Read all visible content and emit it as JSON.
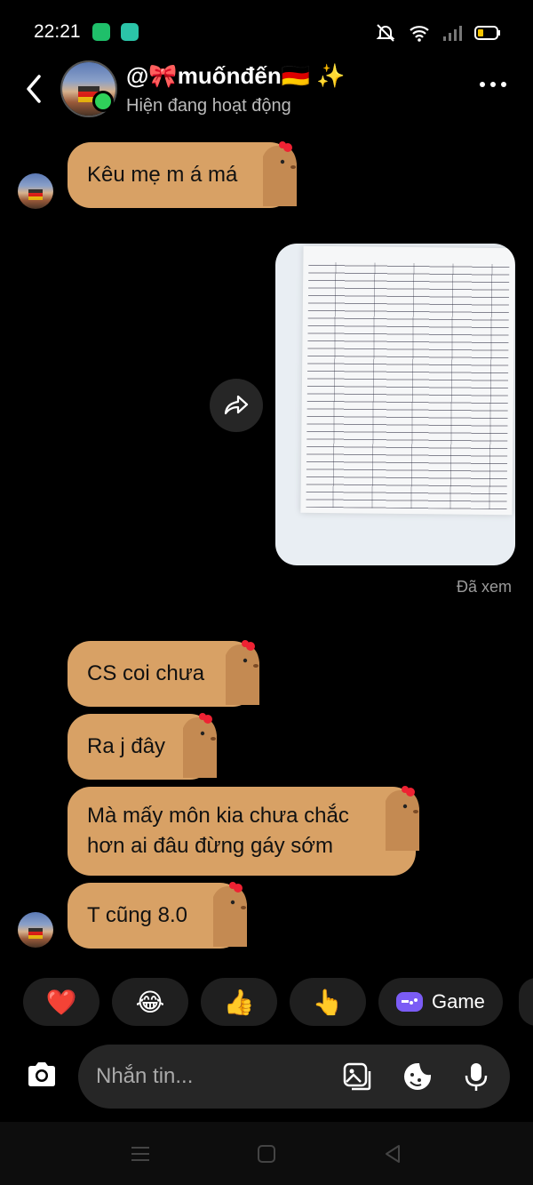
{
  "status_bar": {
    "time": "22:21"
  },
  "header": {
    "contact_name": "@🎀muốnđến🇩🇪 ✨",
    "status": "Hiện đang hoạt động"
  },
  "messages": [
    {
      "sender": "them",
      "text": "Kêu mẹ m á má"
    },
    {
      "sender": "me",
      "type": "image",
      "alt": "photo of a grade sheet"
    },
    {
      "sender": "them",
      "text": "CS coi chưa"
    },
    {
      "sender": "them",
      "text": "Ra j đây"
    },
    {
      "sender": "them",
      "text": "Mà mấy môn kia chưa chắc hơn ai đâu đừng gáy sớm"
    },
    {
      "sender": "them",
      "text": "T cũng 8.0"
    }
  ],
  "seen_label": "Đã xem",
  "quick_reactions": [
    {
      "emoji": "❤️",
      "icon": "heart-icon"
    },
    {
      "emoji": "😂",
      "icon": "laughing-face-icon"
    },
    {
      "emoji": "👍",
      "icon": "thumbs-up-icon"
    },
    {
      "emoji": "👆",
      "icon": "pointing-up-icon"
    },
    {
      "label": "Game",
      "icon": "gamepad-icon"
    }
  ],
  "composer": {
    "placeholder": "Nhắn tin..."
  },
  "colors": {
    "bubble": "#d8a165",
    "background": "#000000",
    "online": "#2fd15a",
    "game_icon": "#7b5cf5"
  }
}
